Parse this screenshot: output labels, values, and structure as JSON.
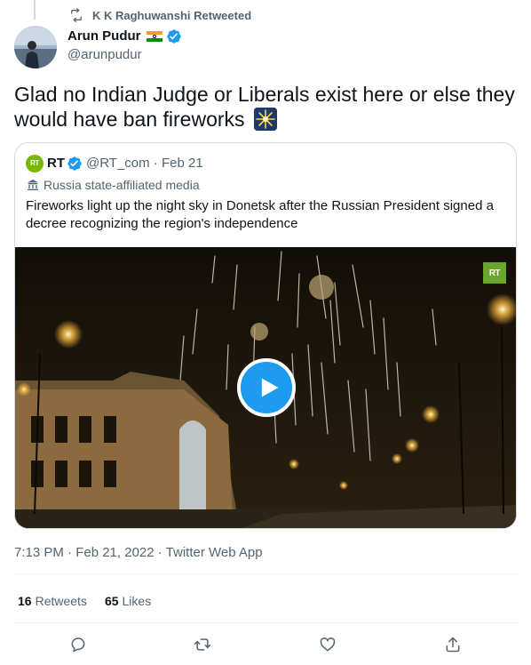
{
  "retweet": {
    "label": "K K Raghuwanshi Retweeted"
  },
  "author": {
    "name": "Arun Pudur",
    "handle": "@arunpudur",
    "flag_icon": "india-flag-icon",
    "verified_icon": "verified-badge-icon"
  },
  "tweet": {
    "text": "Glad no Indian Judge or Liberals exist here or else they would have ban fireworks",
    "emoji_icon": "fireworks-emoji-icon"
  },
  "quote": {
    "logo_text": "RT",
    "name": "RT",
    "handle_date": "@RT_com · Feb 21",
    "affiliation": "Russia state-affiliated media",
    "text": "Fireworks light up the night sky in Donetsk after the Russian President signed a decree recognizing the region's independence",
    "video": {
      "watermark": "RT",
      "play_icon": "play-icon"
    }
  },
  "meta": {
    "timestamp": "7:13 PM · Feb 21, 2022 · Twitter Web App"
  },
  "stats": {
    "retweets_count": "16",
    "retweets_label": "Retweets",
    "likes_count": "65",
    "likes_label": "Likes"
  },
  "actions": [
    "reply-icon",
    "retweet-icon",
    "like-icon",
    "share-icon"
  ],
  "colors": {
    "accent": "#1d9bf0",
    "text": "#0f1419",
    "secondary": "#536471",
    "border": "#cfd9de",
    "rt_green": "#7ab800"
  }
}
